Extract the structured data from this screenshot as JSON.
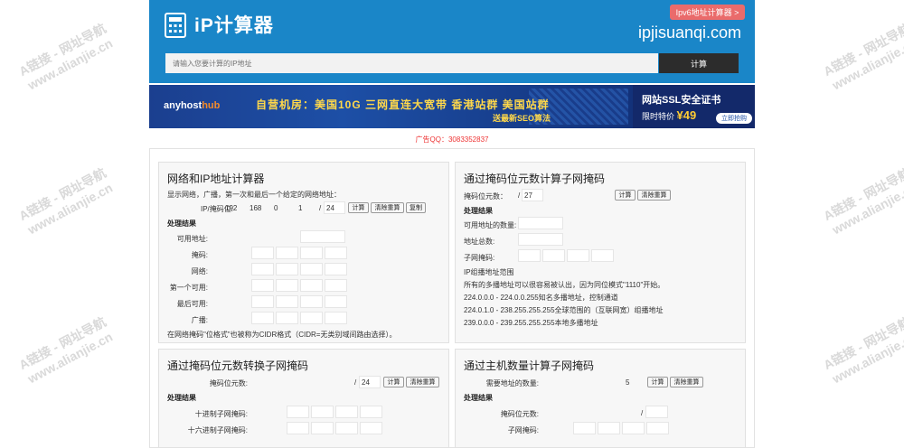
{
  "header": {
    "logo_text": "iP计算器",
    "ipv6_button": "Ipv6地址计算器 >",
    "domain": "ipjisuanqi.com",
    "search_placeholder": "请输入您要计算的IP地址",
    "search_button": "计算"
  },
  "banner": {
    "brand": "anyhost",
    "brand_accent": "hub",
    "slogan": "自营机房：美国10G  三网直连大宽带  香港站群  美国站群",
    "sub": "送最新SEO算法",
    "ssl_title": "网站SSL安全证书",
    "ssl_price_label": "限时特价",
    "ssl_price": "¥49",
    "ssl_button": "立即抢购"
  },
  "ad_text": "广告QQ：3083352837",
  "panel1": {
    "title": "网络和IP地址计算器",
    "desc": "显示网络，广播，第一次和最后一个给定的网络地址：",
    "ip_label": "IP/掩码位:",
    "ip": [
      "192",
      "168",
      "0",
      "1"
    ],
    "mask": "24",
    "buttons": [
      "计算",
      "清除重算",
      "复制"
    ],
    "result_heading": "处理结果",
    "rows": [
      "可用地址:",
      "掩码:",
      "网络:",
      "第一个可用:",
      "最后可用:",
      "广播:"
    ],
    "note": "在网络掩码\"位格式\"也被称为CIDR格式（CIDR=无类别域间路由选择）。"
  },
  "panel2": {
    "title": "通过掩码位元数计算子网掩码",
    "mask_label": "掩码位元数：",
    "mask": "27",
    "buttons": [
      "计算",
      "清除重算"
    ],
    "result_heading": "处理结果",
    "rows": [
      "可用地址的数量:",
      "地址总数:",
      "子网掩码:"
    ],
    "info": [
      "IP组播地址范围",
      "所有的多播地址可以很容易被认出，因为同位模式\"1110\"开始。",
      "224.0.0.0 - 224.0.0.255知名多播地址，控制通道",
      "224.0.1.0 - 238.255.255.255全球范围的（互联网宽）组播地址",
      "239.0.0.0 - 239.255.255.255本地多播地址"
    ]
  },
  "panel3": {
    "title": "通过掩码位元数转换子网掩码",
    "mask_label": "掩码位元数:",
    "mask": "24",
    "buttons": [
      "计算",
      "清除重算"
    ],
    "result_heading": "处理结果",
    "rows": [
      "十进制子网掩码:",
      "十六进制子网掩码:"
    ]
  },
  "panel4": {
    "title": "通过主机数量计算子网掩码",
    "hosts_label": "需要地址的数量:",
    "hosts": "5",
    "buttons": [
      "计算",
      "清除重算"
    ],
    "result_heading": "处理结果",
    "rows": [
      "掩码位元数:",
      "子网掩码:"
    ]
  },
  "slash": "/",
  "watermark": {
    "line1": "A链接 - 网址导航",
    "line2": "www.alianjie.cn"
  }
}
